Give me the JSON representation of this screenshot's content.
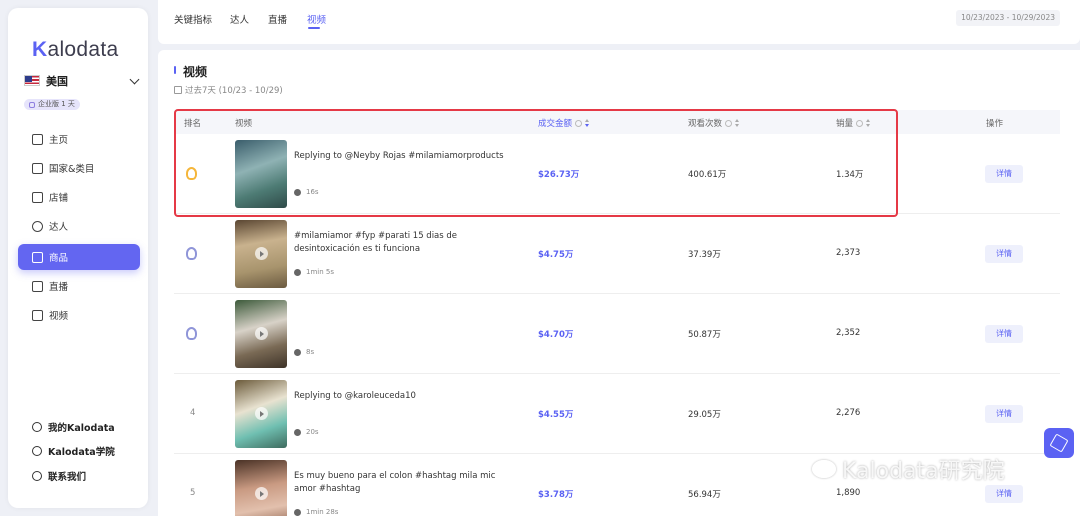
{
  "brand": {
    "logo_text": "Kalodata",
    "accent": "#5b62f3",
    "highlight_border": "#e53946"
  },
  "region": {
    "label": "美国",
    "plan_badge": "企业版 1 天"
  },
  "sidebar": {
    "items": [
      {
        "label": "主页",
        "icon": "home-icon"
      },
      {
        "label": "国家&类目",
        "icon": "category-icon"
      },
      {
        "label": "店铺",
        "icon": "store-icon"
      },
      {
        "label": "达人",
        "icon": "creator-icon"
      },
      {
        "label": "商品",
        "icon": "product-icon",
        "active": true
      },
      {
        "label": "直播",
        "icon": "live-icon"
      },
      {
        "label": "视频",
        "icon": "video-icon"
      }
    ],
    "bottom": [
      {
        "label": "我的Kalodata",
        "icon": "user-icon"
      },
      {
        "label": "Kalodata学院",
        "icon": "academy-icon"
      },
      {
        "label": "联系我们",
        "icon": "headset-icon"
      }
    ]
  },
  "header": {
    "tabs": [
      {
        "label": "关键指标"
      },
      {
        "label": "达人"
      },
      {
        "label": "直播"
      },
      {
        "label": "视频",
        "active": true
      }
    ],
    "date_range": "10/23/2023 - 10/29/2023"
  },
  "section": {
    "title": "视频",
    "period": "过去7天 (10/23 - 10/29)"
  },
  "table": {
    "headers": {
      "rank": "排名",
      "video": "视频",
      "amount": "成交金额",
      "views": "观看次数",
      "sales": "销量",
      "action": "操作"
    },
    "detail_label": "详情",
    "rows": [
      {
        "rank": "",
        "medal": "gold",
        "title": "Replying to @Neyby Rojas #milamiamorproducts",
        "duration": "16s",
        "amount": "$26.73万",
        "views": "400.61万",
        "sales": "1.34万"
      },
      {
        "rank": "",
        "medal": "silver",
        "title": "#milamiamor #fyp #parati 15 dias de desintoxicación es ti funciona",
        "duration": "1min 5s",
        "amount": "$4.75万",
        "views": "37.39万",
        "sales": "2,373"
      },
      {
        "rank": "",
        "medal": "silver",
        "title": "",
        "duration": "8s",
        "amount": "$4.70万",
        "views": "50.87万",
        "sales": "2,352"
      },
      {
        "rank": "4",
        "medal": "",
        "title": "Replying to @karoleuceda10",
        "duration": "20s",
        "amount": "$4.55万",
        "views": "29.05万",
        "sales": "2,276"
      },
      {
        "rank": "5",
        "medal": "",
        "title": "Es muy bueno para el colon #hashtag mila mic amor #hashtag",
        "duration": "1min 28s",
        "amount": "$3.78万",
        "views": "56.94万",
        "sales": "1,890"
      }
    ]
  },
  "watermark": "Kalodata研究院"
}
